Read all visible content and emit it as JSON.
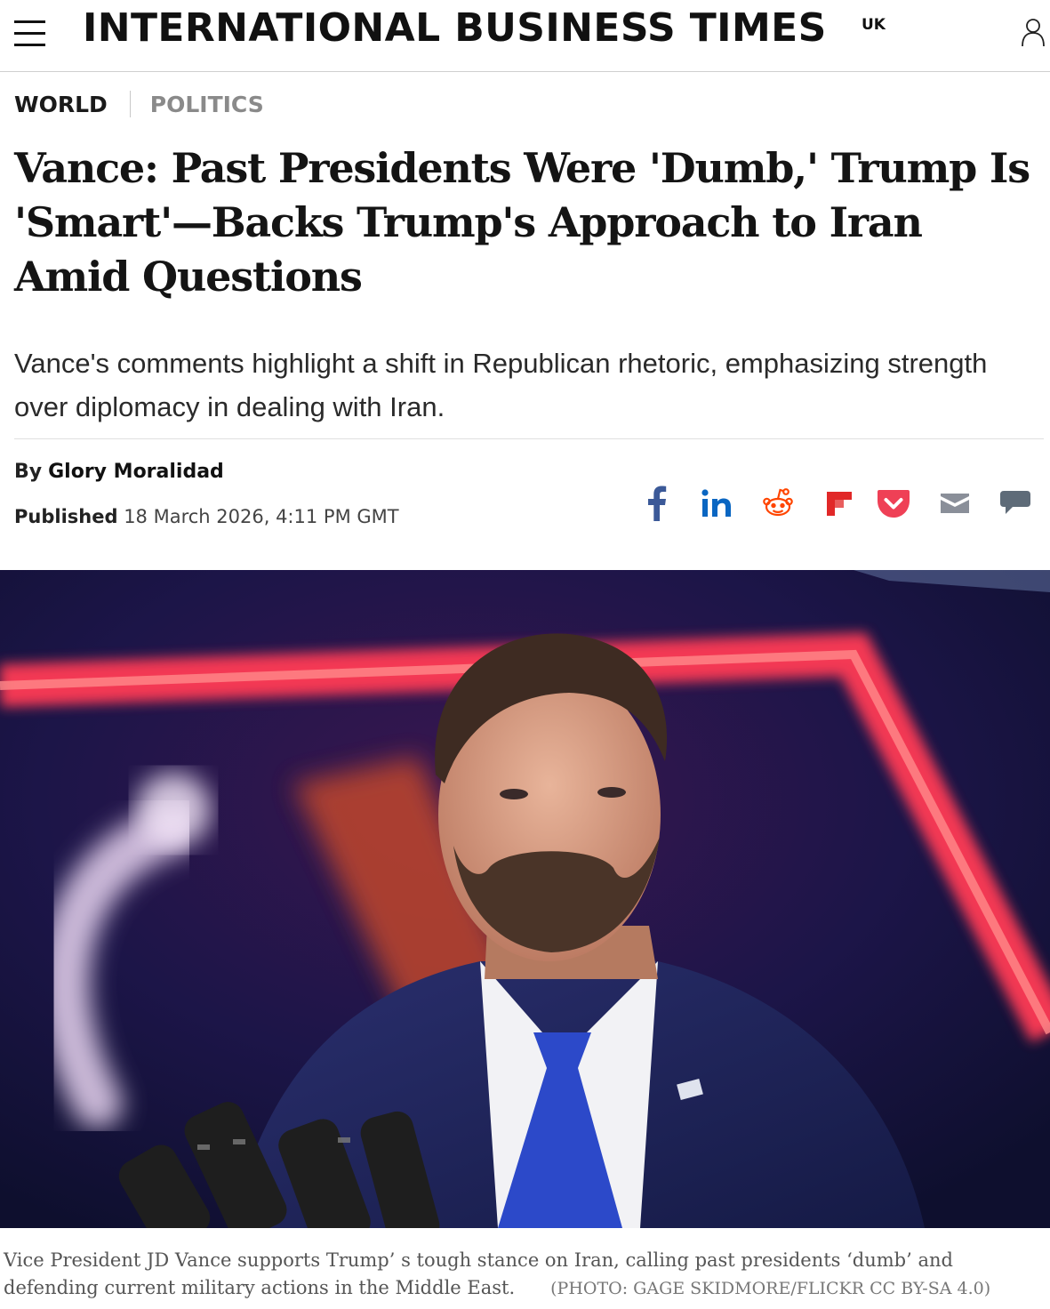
{
  "header": {
    "logo": "INTERNATIONAL BUSINESS TIMES",
    "edition": "UK",
    "menu_icon": "hamburger-menu-icon",
    "user_icon": "user-account-icon"
  },
  "categories": {
    "primary": "WORLD",
    "secondary": "POLITICS"
  },
  "article": {
    "headline": "Vance: Past Presidents Were 'Dumb,' Trump Is 'Smart'—Backs Trump's Approach to Iran Amid Questions",
    "subheadline": "Vance's comments highlight a shift in Republican rhetoric, emphasizing strength over diplomacy in dealing with Iran.",
    "by_label": "By",
    "author": "Glory Moralidad",
    "published_label": "Published",
    "published_date": "18 March 2026, 4:11 PM GMT"
  },
  "share": [
    {
      "name": "facebook",
      "icon": "facebook-icon",
      "color": "#3b5998"
    },
    {
      "name": "linkedin",
      "icon": "linkedin-icon",
      "color": "#0a66c2"
    },
    {
      "name": "reddit",
      "icon": "reddit-icon",
      "color": "#ff4500"
    },
    {
      "name": "flipboard",
      "icon": "flipboard-icon",
      "color": "#e12828"
    },
    {
      "name": "pocket",
      "icon": "pocket-icon",
      "color": "#ef4056"
    },
    {
      "name": "email",
      "icon": "email-icon",
      "color": "#8a8f99"
    },
    {
      "name": "comments",
      "icon": "comment-icon",
      "color": "#5e6b78"
    }
  ],
  "image": {
    "caption": "Vice President JD Vance supports Trump’ s tough stance on Iran, calling past presidents ‘dumb’  and defending current military actions in the Middle East.",
    "credit": "(PHOTO: GAGE SKIDMORE/FLICKR CC BY-SA 4.0)"
  }
}
